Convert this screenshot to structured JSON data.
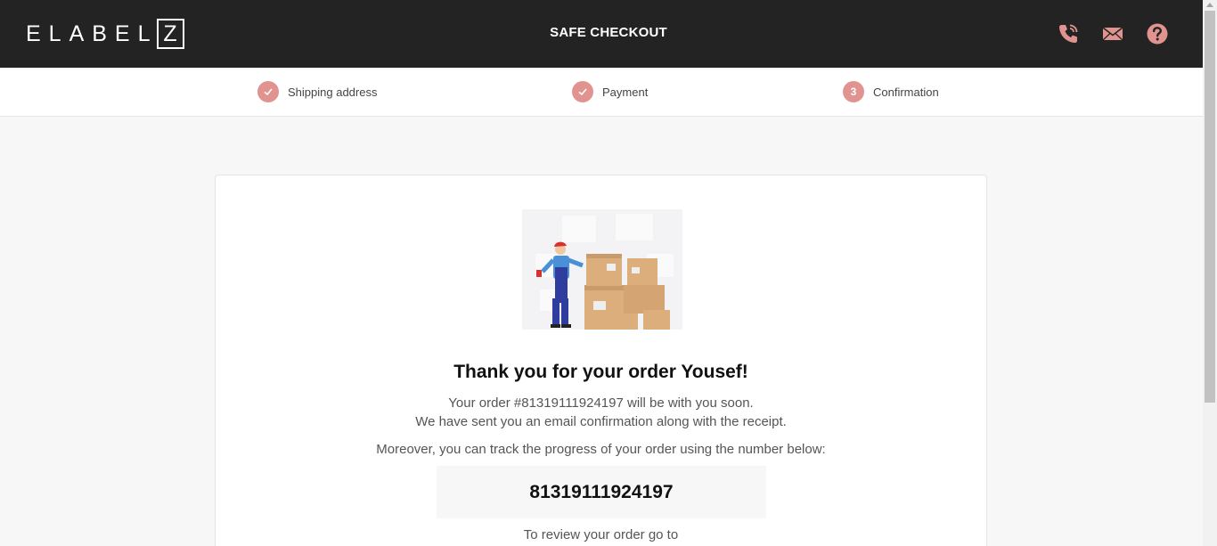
{
  "header": {
    "logo_text": "ELABEL",
    "logo_box_letter": "Z",
    "title": "SAFE CHECKOUT",
    "icons": [
      "phone-icon",
      "mail-icon",
      "help-icon"
    ]
  },
  "steps": [
    {
      "label": "Shipping address",
      "state": "done"
    },
    {
      "label": "Payment",
      "state": "done"
    },
    {
      "label": "Confirmation",
      "state": "current",
      "number": "3"
    }
  ],
  "confirmation": {
    "heading": "Thank you for your order Yousef!",
    "line1": "Your order #81319111924197 will be with you soon.",
    "line2": "We have sent you an email confirmation along with the receipt.",
    "line3": "Moreover, you can track the progress of your order using the number below:",
    "tracking_number": "81319111924197",
    "review_text": "To review your order go to"
  },
  "colors": {
    "header_bg": "#232323",
    "accent": "#e0938f",
    "page_bg": "#f7f7f8"
  }
}
